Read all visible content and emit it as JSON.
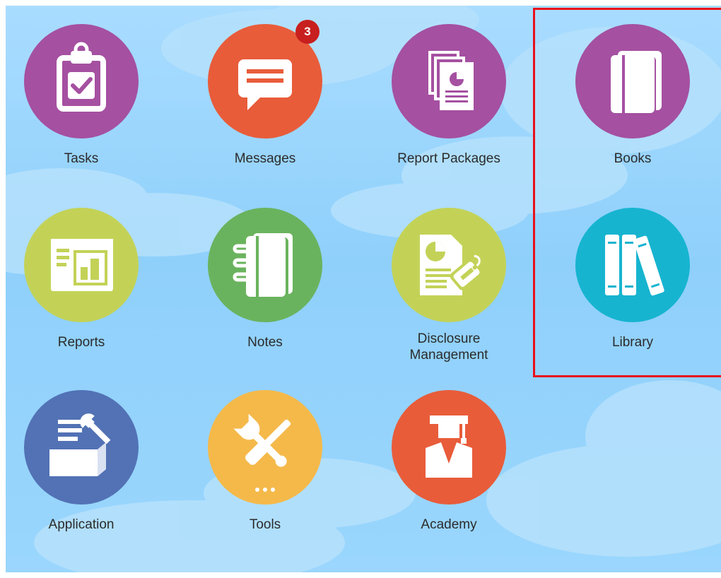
{
  "tiles": [
    {
      "id": "tasks",
      "label": "Tasks",
      "icon": "clipboard-check-icon",
      "color": "#a550a1"
    },
    {
      "id": "messages",
      "label": "Messages",
      "icon": "message-icon",
      "color": "#e85c3a",
      "badge": "3"
    },
    {
      "id": "report-packages",
      "label": "Report Packages",
      "icon": "report-packages-icon",
      "color": "#a550a1"
    },
    {
      "id": "books",
      "label": "Books",
      "icon": "books-icon",
      "color": "#a550a1"
    },
    {
      "id": "reports",
      "label": "Reports",
      "icon": "report-icon",
      "color": "#c3d257"
    },
    {
      "id": "notes",
      "label": "Notes",
      "icon": "notebook-icon",
      "color": "#6ab35e"
    },
    {
      "id": "disclosure-management",
      "label": "Disclosure\nManagement",
      "icon": "disclosure-document-icon",
      "color": "#c3d257"
    },
    {
      "id": "library",
      "label": "Library",
      "icon": "library-books-icon",
      "color": "#17b4d0"
    },
    {
      "id": "application",
      "label": "Application",
      "icon": "application-box-icon",
      "color": "#5272b5"
    },
    {
      "id": "tools",
      "label": "Tools",
      "icon": "tools-icon",
      "color": "#f5b94a"
    },
    {
      "id": "academy",
      "label": "Academy",
      "icon": "graduate-icon",
      "color": "#e85c3a"
    }
  ],
  "highlight": {
    "color": "#e8101a",
    "covers": [
      "Books",
      "Library"
    ]
  }
}
